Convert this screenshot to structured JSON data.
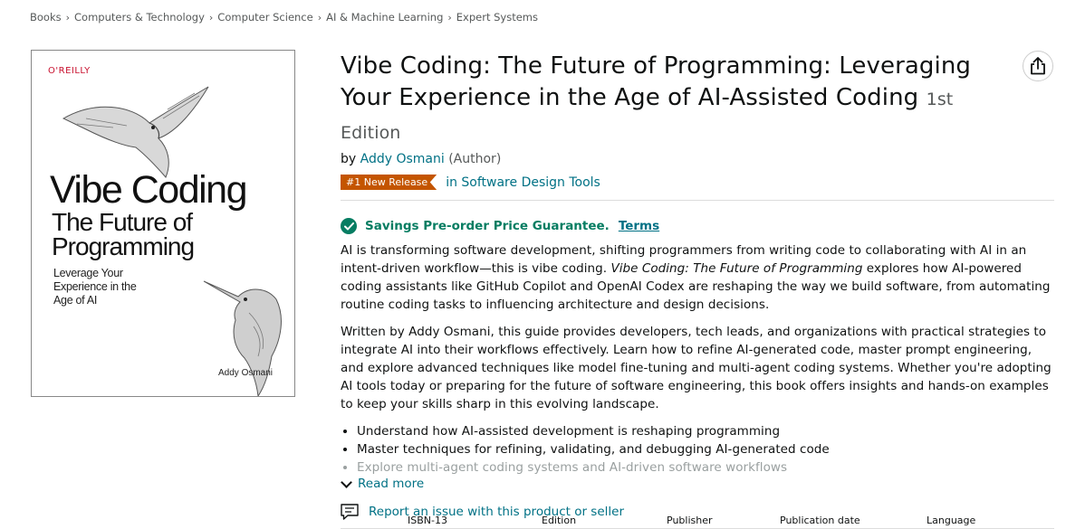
{
  "breadcrumb": [
    "Books",
    "Computers & Technology",
    "Computer Science",
    "AI & Machine Learning",
    "Expert Systems"
  ],
  "cover": {
    "publisher": "O'REILLY",
    "title_line1": "Vibe Coding",
    "title_line2": "The Future of",
    "title_line3": "Programming",
    "tagline": "Leverage Your Experience in the Age of AI",
    "author": "Addy Osmani"
  },
  "product": {
    "title": "Vibe Coding: The Future of Programming: Leveraging Your Experience in the Age of AI-Assisted Coding",
    "edition": "1st Edition",
    "by_label": "by",
    "author": "Addy Osmani",
    "author_role": "(Author)",
    "badge": "#1 New Release",
    "badge_category": "in Software Design Tools"
  },
  "guarantee": {
    "text": "Savings Pre-order Price Guarantee.",
    "terms": "Terms"
  },
  "description": {
    "p1_a": "AI is transforming software development, shifting programmers from writing code to collaborating with AI in an intent-driven workflow—this is vibe coding. ",
    "p1_italic": "Vibe Coding: The Future of Programming",
    "p1_b": " explores how AI-powered coding assistants like GitHub Copilot and OpenAI Codex are reshaping the way we build software, from automating routine coding tasks to influencing architecture and design decisions.",
    "p2": "Written by Addy Osmani, this guide provides developers, tech leads, and organizations with practical strategies to integrate AI into their workflows effectively. Learn how to refine AI-generated code, master prompt engineering, and explore advanced techniques like model fine-tuning and multi-agent coding systems. Whether you're adopting AI tools today or preparing for the future of software engineering, this book offers insights and hands-on examples to keep your skills sharp in this evolving landscape.",
    "bullets": [
      "Understand how AI-assisted development is reshaping programming",
      "Master techniques for refining, validating, and debugging AI-generated code",
      "Explore multi-agent coding systems and AI-driven software workflows"
    ]
  },
  "read_more": "Read more",
  "report": "Report an issue with this product or seller",
  "details_headers": [
    "ISBN-13",
    "Edition",
    "Publisher",
    "Publication date",
    "Language"
  ],
  "colors": {
    "link": "#007185",
    "badge": "#c45500",
    "guarantee": "#067d62"
  },
  "icons": [
    "share-icon",
    "check-circle-icon",
    "chevron-down-icon",
    "report-flag-icon"
  ]
}
